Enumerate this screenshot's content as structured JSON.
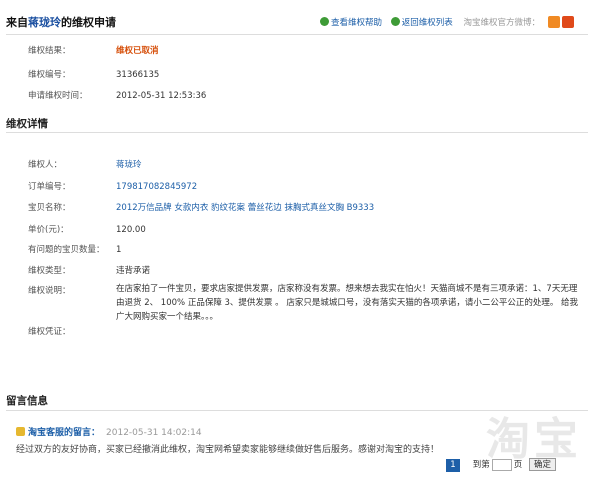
{
  "header": {
    "title_prefix": "来自",
    "title_user": "蒋珑玲",
    "title_suffix": "的维权申请",
    "help_link": "查看维权帮助",
    "back_link": "返回维权列表",
    "weibo_text": "淘宝维权官方微博："
  },
  "summary": {
    "status_label": "维权结果：",
    "status_value": "维权已取消",
    "id_label": "维权编号：",
    "id_value": "31366135",
    "time_label": "申请维权时间：",
    "time_value": "2012-05-31 12:53:36"
  },
  "details": {
    "section_title": "维权详情",
    "applicant_label": "维权人：",
    "applicant_value": "蒋珑玲",
    "order_label": "订单编号：",
    "order_value": "179817082845972",
    "item_label": "宝贝名称：",
    "item_value": "2012万信品牌 女款内衣 豹纹花案 蕾丝花边 抹胸式真丝文胸 B9333",
    "price_label": "单价(元)：",
    "price_value": "120.00",
    "qty_label": "有问题的宝贝数量：",
    "qty_value": "1",
    "type_label": "维权类型：",
    "type_value": "违背承诺",
    "desc_label": "维权说明：",
    "desc_value": "在店家拍了一件宝贝，要求店家提供发票，店家称没有发票。想来想去我实在怕火！天猫商城不是有三项承诺：1、7天无理由退货 2、 100% 正品保障 3、提供发票 。 店家只是城城口号，没有落实天猫的各项承诺，请小二公平公正的处理。 给我广大网购买家一个结果。。。",
    "proof_label": "维权凭证："
  },
  "messages": {
    "section_title": "留言信息",
    "author": "淘宝客服的留言：",
    "time": "2012-05-31 14:02:14",
    "body": "经过双方的友好协商，买家已经撤消此维权，淘宝网希望卖家能够继续做好售后服务。感谢对淘宝的支持！"
  },
  "pager": {
    "current_page": "1",
    "jump_label": "到第",
    "page_label": "页",
    "ok_label": "确定"
  },
  "watermark": {
    "text": "淘宝"
  }
}
